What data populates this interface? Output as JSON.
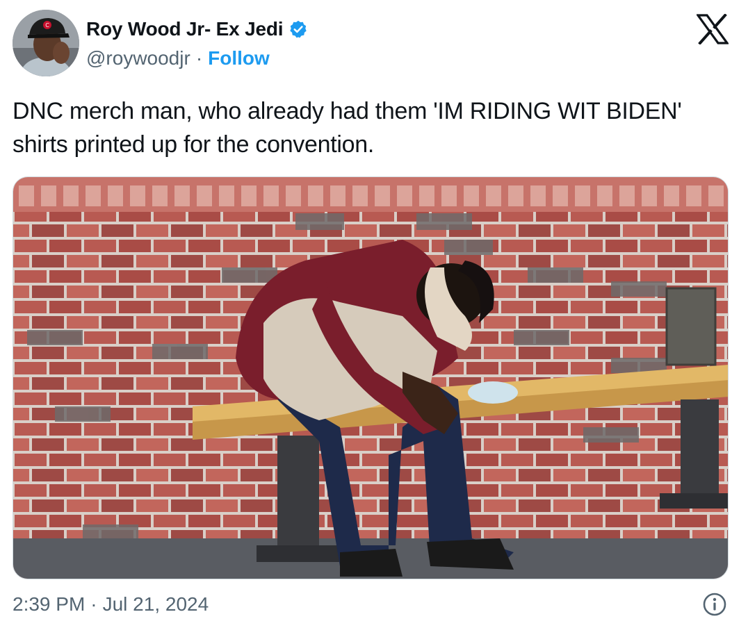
{
  "author": {
    "display_name": "Roy Wood Jr- Ex Jedi",
    "handle": "@roywoodjr",
    "separator": "·",
    "follow_label": "Follow",
    "verified": true
  },
  "tweet": {
    "text": "DNC merch man, who already had them 'IM RIDING WIT BIDEN' shirts printed up for the convention.",
    "time": "2:39 PM",
    "date": "Jul 21, 2024",
    "meta_separator": "·"
  },
  "icons": {
    "platform_logo": "x-logo-icon",
    "verified": "verified-badge-icon",
    "info": "info-icon"
  },
  "colors": {
    "accent": "#1d9bf0",
    "text_primary": "#0f1419",
    "text_secondary": "#536471"
  }
}
